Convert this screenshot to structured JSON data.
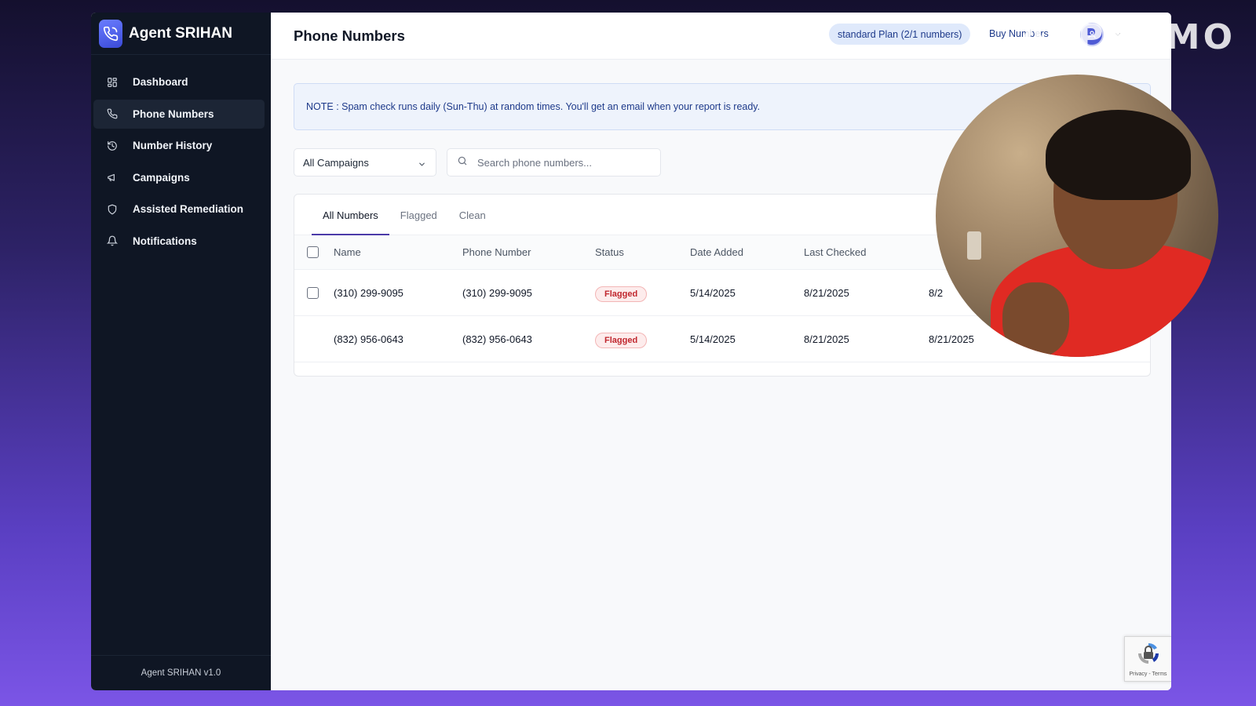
{
  "watermark": "APPSUMO",
  "sidebar": {
    "brand": "Agent SRIHAN",
    "items": [
      {
        "label": "Dashboard",
        "icon": "dashboard-icon"
      },
      {
        "label": "Phone Numbers",
        "icon": "phone-icon",
        "active": true
      },
      {
        "label": "Number History",
        "icon": "history-icon"
      },
      {
        "label": "Campaigns",
        "icon": "megaphone-icon"
      },
      {
        "label": "Assisted Remediation",
        "icon": "shield-icon"
      },
      {
        "label": "Notifications",
        "icon": "bell-icon"
      }
    ],
    "footer": "Agent SRIHAN v1.0"
  },
  "header": {
    "title": "Phone Numbers",
    "plan_badge": "standard Plan (2/1 numbers)",
    "buy_link": "Buy Numbers"
  },
  "note": "NOTE : Spam check runs daily (Sun-Thu) at random times. You'll get an email when your report is ready.",
  "filters": {
    "campaign_select": "All Campaigns",
    "search_placeholder": "Search phone numbers..."
  },
  "tabs": [
    {
      "label": "All Numbers",
      "active": true
    },
    {
      "label": "Flagged"
    },
    {
      "label": "Clean"
    }
  ],
  "table": {
    "columns": [
      "Name",
      "Phone Number",
      "Status",
      "Date Added",
      "Last Checked"
    ],
    "rows": [
      {
        "name": "(310) 299-9095",
        "phone": "(310) 299-9095",
        "status": "Flagged",
        "date_added": "5/14/2025",
        "last_checked": "8/21/2025",
        "extra": "8/2"
      },
      {
        "name": "(832) 956-0643",
        "phone": "(832) 956-0643",
        "status": "Flagged",
        "date_added": "5/14/2025",
        "last_checked": "8/21/2025",
        "extra": "8/21/2025"
      }
    ]
  },
  "recaptcha": {
    "text": "Privacy - Terms"
  },
  "colors": {
    "sidebar_bg": "#0f1624",
    "accent": "#4b3aa8",
    "flagged": "#c0262d",
    "note_text": "#1e3a8a"
  }
}
